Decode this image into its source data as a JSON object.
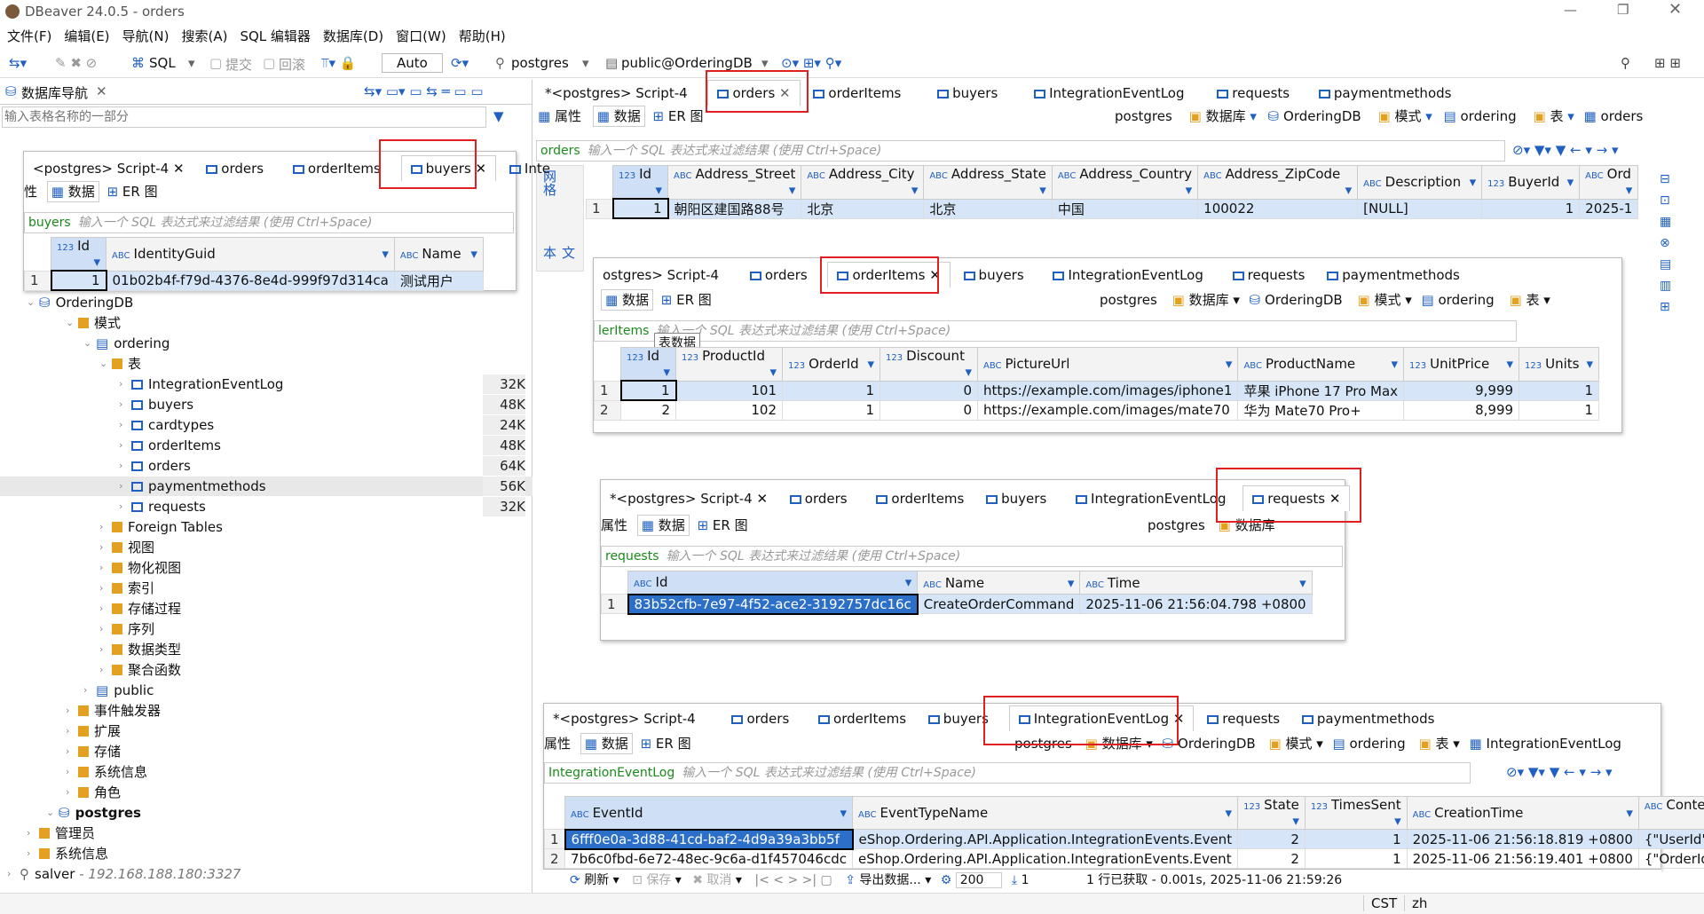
{
  "window": {
    "title": "DBeaver 24.0.5 - orders"
  },
  "menu": [
    "文件(F)",
    "编辑(E)",
    "导航(N)",
    "搜索(A)",
    "SQL 编辑器",
    "数据库(D)",
    "窗口(W)",
    "帮助(H)"
  ],
  "toolbar": {
    "sql": "SQL",
    "commit": "提交",
    "rollback": "回滚",
    "mode": "Auto",
    "connection": "postgres",
    "schema": "public@OrderingDB"
  },
  "navigator": {
    "title": "数据库导航",
    "search_placeholder": "输入表格名称的一部分",
    "tree": [
      {
        "label": "OrderingDB"
      },
      {
        "label": "模式"
      },
      {
        "label": "ordering"
      },
      {
        "label": "表"
      },
      {
        "label": "IntegrationEventLog",
        "size": "32K"
      },
      {
        "label": "buyers",
        "size": "48K"
      },
      {
        "label": "cardtypes",
        "size": "24K"
      },
      {
        "label": "orderItems",
        "size": "48K"
      },
      {
        "label": "orders",
        "size": "64K"
      },
      {
        "label": "paymentmethods",
        "size": "56K"
      },
      {
        "label": "requests",
        "size": "32K"
      },
      {
        "label": "Foreign Tables"
      },
      {
        "label": "视图"
      },
      {
        "label": "物化视图"
      },
      {
        "label": "索引"
      },
      {
        "label": "存储过程"
      },
      {
        "label": "序列"
      },
      {
        "label": "数据类型"
      },
      {
        "label": "聚合函数"
      },
      {
        "label": "public"
      },
      {
        "label": "事件触发器"
      },
      {
        "label": "扩展"
      },
      {
        "label": "存储"
      },
      {
        "label": "系统信息"
      },
      {
        "label": "角色"
      },
      {
        "label": "postgres"
      },
      {
        "label": "管理员"
      },
      {
        "label": "系统信息"
      },
      {
        "label": "salver",
        "extra": " - 192.168.188.180:3327"
      }
    ]
  },
  "common": {
    "script_tab": "<postgres> Script-4",
    "script_tab_dirty": "*<postgres> Script-4",
    "tabs": [
      "orders",
      "orderItems",
      "buyers",
      "IntegrationEventLog",
      "requests",
      "paymentmethods"
    ],
    "subtabs": [
      "属性",
      "数据",
      "ER 图"
    ],
    "filter_placeholder": "输入一个 SQL 表达式来过滤结果 (使用 Ctrl+Space)",
    "crumbs": [
      "postgres",
      "数据库",
      "OrderingDB",
      "模式",
      "ordering",
      "表"
    ],
    "tooltip": "表数据"
  },
  "orders": {
    "columns": [
      "Id",
      "Address_Street",
      "Address_City",
      "Address_State",
      "Address_Country",
      "Address_ZipCode",
      "Description",
      "BuyerId",
      "Ord"
    ],
    "rows": [
      [
        "1",
        "1",
        "朝阳区建国路88号",
        "北京",
        "北京",
        "中国",
        "100022",
        "[NULL]",
        "1",
        "2025-1"
      ]
    ]
  },
  "buyers": {
    "filter_label": "buyers",
    "columns": [
      "Id",
      "IdentityGuid",
      "Name"
    ],
    "rows": [
      [
        "1",
        "1",
        "01b02b4f-f79d-4376-8e4d-999f97d314ca",
        "测试用户"
      ]
    ]
  },
  "orderitems": {
    "filter_label": "lerItems",
    "columns": [
      "Id",
      "ProductId",
      "OrderId",
      "Discount",
      "PictureUrl",
      "ProductName",
      "UnitPrice",
      "Units"
    ],
    "rows": [
      [
        "1",
        "1",
        "101",
        "1",
        "0",
        "https://example.com/images/iphone1",
        "苹果 iPhone 17 Pro Max",
        "9,999",
        "1"
      ],
      [
        "2",
        "2",
        "102",
        "1",
        "0",
        "https://example.com/images/mate70",
        "华为 Mate70 Pro+",
        "8,999",
        "1"
      ]
    ]
  },
  "requests": {
    "filter_label": "requests",
    "columns": [
      "Id",
      "Name",
      "Time"
    ],
    "rows": [
      [
        "1",
        "83b52cfb-7e97-4f52-ace2-3192757dc16c",
        "CreateOrderCommand",
        "2025-11-06 21:56:04.798 +0800"
      ]
    ]
  },
  "eventlog": {
    "filter_label": "IntegrationEventLog",
    "columns": [
      "EventId",
      "EventTypeName",
      "State",
      "TimesSent",
      "CreationTime",
      "Content"
    ],
    "rows": [
      [
        "1",
        "6fff0e0a-3d88-41cd-baf2-4d9a39a3bb5f",
        "eShop.Ordering.API.Application.IntegrationEvents.Event",
        "2",
        "1",
        "2025-11-06 21:56:18.819 +0800",
        "{\"UserId\": \""
      ],
      [
        "2",
        "7b6c0fbd-6e72-48ec-9c6a-d1f457046cdc",
        "eShop.Ordering.API.Application.IntegrationEvents.Event",
        "2",
        "1",
        "2025-11-06 21:56:19.401 +0800",
        "{\"OrderId\":"
      ]
    ],
    "crumb_last": "IntegrationEventLog"
  },
  "bottombar": {
    "refresh": "刷新",
    "save": "保存",
    "cancel": "取消",
    "export": "导出数据...",
    "limit": "200",
    "count": "1",
    "status": "1 行已获取 - 0.001s, 2025-11-06 21:59:26"
  },
  "statusbar": {
    "tz": "CST",
    "lang": "zh"
  }
}
